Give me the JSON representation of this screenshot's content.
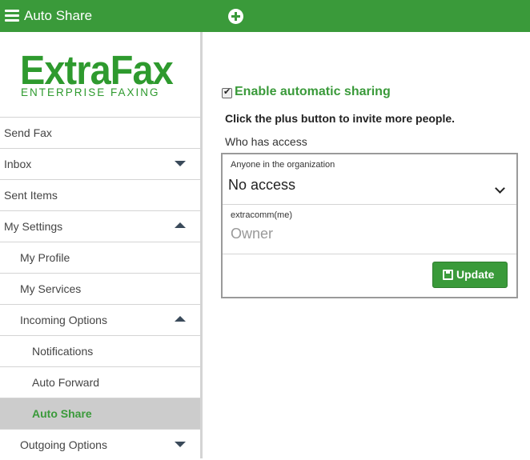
{
  "header": {
    "title": "Auto Share",
    "menu_icon": "hamburger-menu-icon",
    "add_icon": "plus-circle-icon"
  },
  "logo": {
    "name": "ExtraFax",
    "tagline": "ENTERPRISE FAXING"
  },
  "sidebar": {
    "items": [
      {
        "label": "Send Fax",
        "level": 0,
        "caret": null,
        "active": false
      },
      {
        "label": "Inbox",
        "level": 0,
        "caret": "down",
        "active": false
      },
      {
        "label": "Sent Items",
        "level": 0,
        "caret": null,
        "active": false
      },
      {
        "label": "My Settings",
        "level": 0,
        "caret": "up",
        "active": false
      },
      {
        "label": "My Profile",
        "level": 1,
        "caret": null,
        "active": false
      },
      {
        "label": "My Services",
        "level": 1,
        "caret": null,
        "active": false
      },
      {
        "label": "Incoming Options",
        "level": 1,
        "caret": "up",
        "active": false
      },
      {
        "label": "Notifications",
        "level": 2,
        "caret": null,
        "active": false
      },
      {
        "label": "Auto Forward",
        "level": 2,
        "caret": null,
        "active": false
      },
      {
        "label": "Auto Share",
        "level": 2,
        "caret": null,
        "active": true
      },
      {
        "label": "Outgoing Options",
        "level": 1,
        "caret": "down",
        "active": false
      }
    ]
  },
  "main": {
    "enable_label": "Enable automatic sharing",
    "enable_checked": true,
    "instructions": "Click the plus button to invite more people.",
    "who_has_access": "Who has access",
    "access_rows": [
      {
        "sub_label": "Anyone in the organization",
        "value": "No access"
      },
      {
        "sub_label": "extracomm(me)",
        "value": "Owner"
      }
    ],
    "update_label": "Update"
  },
  "colors": {
    "brand_green": "#3a9a3a",
    "active_bg": "#cccccc"
  }
}
